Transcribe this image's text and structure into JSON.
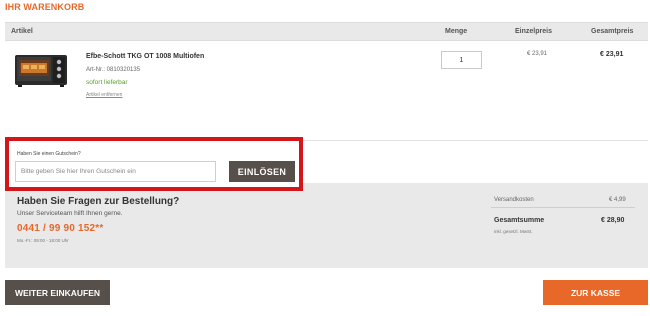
{
  "page_title": "IHR WARENKORB",
  "table_header": {
    "artikel": "Artikel",
    "menge": "Menge",
    "einzelpreis": "Einzelpreis",
    "gesamtpreis": "Gesamtpreis"
  },
  "cart_item": {
    "image_icon": "mini-oven-image",
    "name": "Efbe-Schott TKG OT 1008 Multiofen",
    "article_number": "Art-Nr.: 0810320135",
    "availability": "sofort lieferbar",
    "remove_link": "Artikel entfernen",
    "quantity": "1",
    "unit_price": "€ 23,91",
    "total_price": "€ 23,91"
  },
  "voucher": {
    "label": "Haben Sie einen Gutschein?",
    "placeholder": "Bitte geben Sie hier Ihren Gutschein ein",
    "button_label": "EINLÖSEN"
  },
  "service": {
    "title": "Haben Sie Fragen zur Bestellung?",
    "subtitle": "Unser Serviceteam hilft Ihnen gerne.",
    "phone": "0441 / 99 90 152**",
    "hours": "Mo.-Fr.: 09:00 - 18:00 Uhr"
  },
  "summary": {
    "shipping_label": "Versandkosten",
    "shipping_value": "€ 4,99",
    "total_label": "Gesamtsumme",
    "total_value": "€ 28,90",
    "vat_note": "inkl. gesetzl. MwSt."
  },
  "buttons": {
    "continue_shopping": "WEITER EINKAUFEN",
    "checkout": "ZUR KASSE"
  },
  "colors": {
    "accent": "#e8682a",
    "dark_button": "#574f4a",
    "highlight_border": "#d4161b",
    "stock_green": "#5aa02c"
  }
}
